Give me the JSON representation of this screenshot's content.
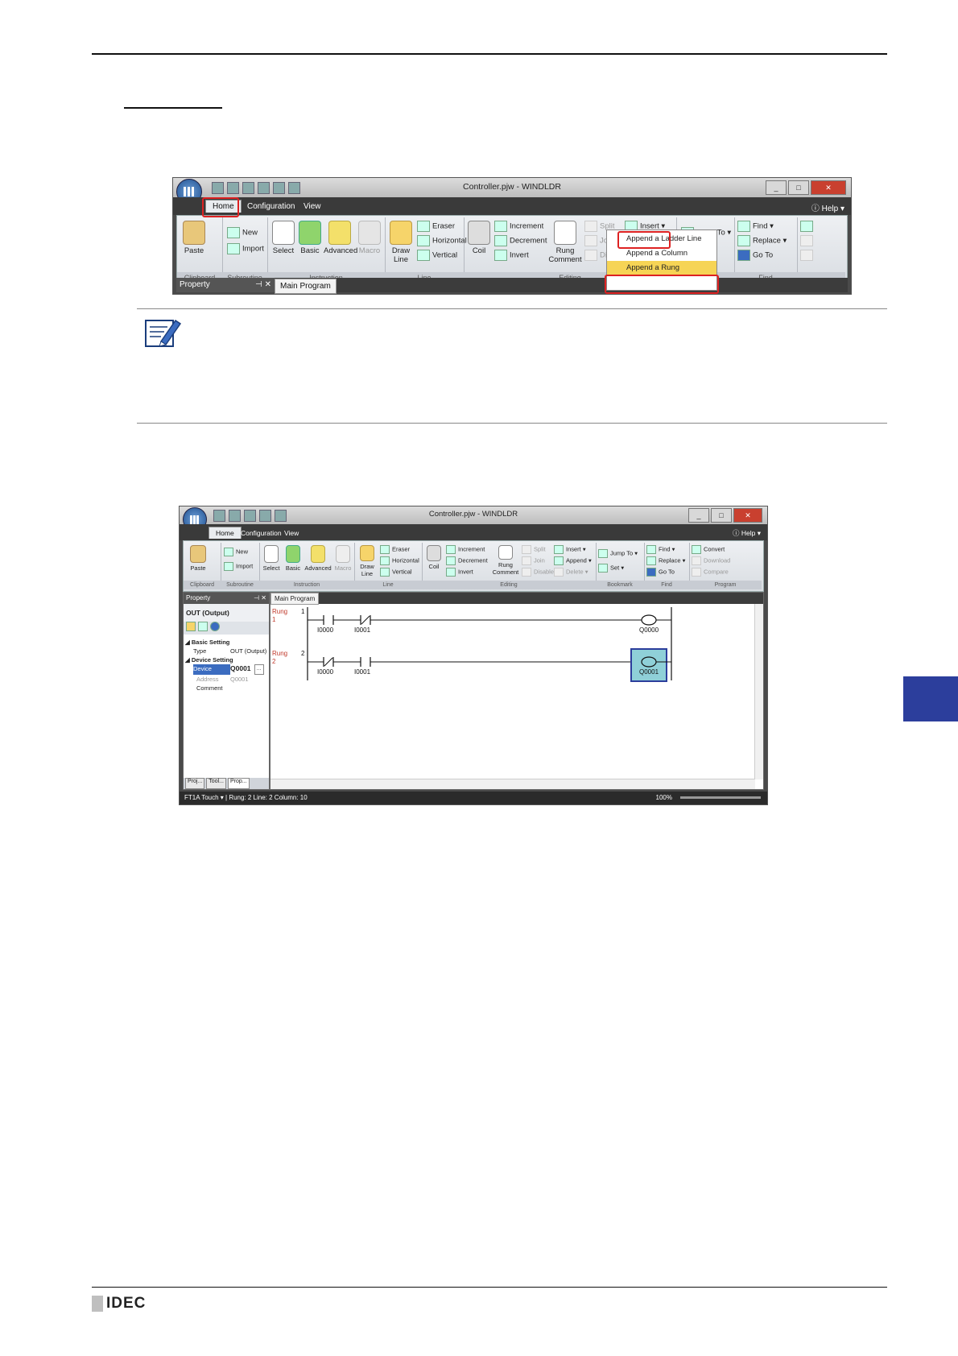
{
  "page": {
    "brand": "IDEC"
  },
  "window": {
    "title": "Controller.pjw - WINDLDR",
    "help": "Help",
    "tabs": [
      "Home",
      "Configuration",
      "View"
    ]
  },
  "ribbon": {
    "clipboard": {
      "label": "Clipboard",
      "paste": "Paste"
    },
    "subroutine": {
      "label": "Subroutine",
      "new": "New",
      "import": "Import"
    },
    "instruction": {
      "label": "Instruction",
      "select": "Select",
      "basic": "Basic",
      "advanced": "Advanced",
      "macro": "Macro"
    },
    "line": {
      "label": "Line",
      "draw": "Draw Line",
      "eraser": "Eraser",
      "horizontal": "Horizontal",
      "vertical": "Vertical"
    },
    "editing": {
      "label": "Editing",
      "coil": "Coil",
      "increment": "Increment",
      "decrement": "Decrement",
      "invert": "Invert",
      "rung_comment": "Rung Comment",
      "split": "Split",
      "join": "Join",
      "disable": "Disable",
      "insert": "Insert",
      "append": "Append",
      "delete": "Delete"
    },
    "bookmark": {
      "label": "Bookmark",
      "jump_to": "Jump To",
      "set": "Set"
    },
    "find": {
      "label": "Find",
      "find": "Find",
      "replace": "Replace",
      "go_to": "Go To"
    },
    "program": {
      "label": "Program",
      "convert": "Convert",
      "download": "Download",
      "compare": "Compare"
    }
  },
  "append_menu": [
    "Append a Ladder Line",
    "Append a Column",
    "Append a Rung"
  ],
  "panels": {
    "property": "Property",
    "main_program": "Main Program"
  },
  "property_panel": {
    "title": "OUT (Output)",
    "basic_setting": "Basic Setting",
    "type_label": "Type",
    "type_value": "OUT (Output)",
    "device_setting": "Device Setting",
    "device_label": "Device",
    "device_value": "Q0001",
    "address_label": "Address",
    "address_value": "Q0001",
    "comment_label": "Comment",
    "bottom_tabs": [
      "Proj...",
      "Tool...",
      "Prop..."
    ]
  },
  "ladder": {
    "rung_word": "Rung",
    "rungs": [
      {
        "number": "1",
        "contacts": [
          "I0000",
          "I0001"
        ],
        "coil": "Q0000"
      },
      {
        "number": "2",
        "contacts": [
          "I0000",
          "I0001"
        ],
        "coil": "Q0001"
      }
    ]
  },
  "status": {
    "model": "FT1A Touch",
    "position": "Rung: 2  Line: 2  Column: 10",
    "zoom": "100%"
  }
}
